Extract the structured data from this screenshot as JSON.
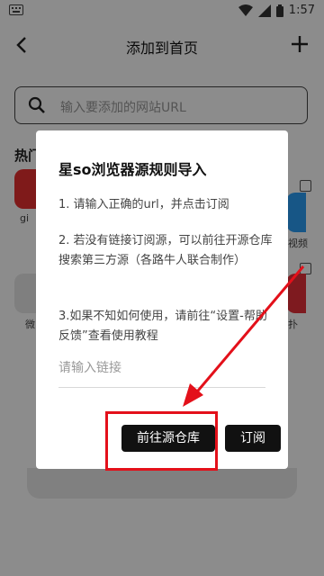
{
  "status_bar": {
    "time": "1:57",
    "left_icon": "keyboard-icon"
  },
  "header": {
    "title": "添加到首页",
    "back_icon": "back-arrow-icon",
    "add_icon": "plus-icon"
  },
  "search": {
    "placeholder": "输入要添加的网站URL",
    "icon": "search-icon"
  },
  "hot": {
    "title_fragment": "热门",
    "left_labels": [
      "gi",
      "微"
    ],
    "right_labels": [
      "视频",
      "扑"
    ]
  },
  "dialog": {
    "title": "星so浏览器源规则导入",
    "step1": "1. 请输入正确的url，并点击订阅",
    "step2": "2. 若没有链接订阅源，可以前往开源仓库搜索第三方源（各路牛人联合制作）",
    "step3": "3.如果不知如何使用，请前往“设置-帮助反馈”查看使用教程",
    "input_placeholder": "请输入链接",
    "repo_button": "前往源仓库",
    "subscribe_button": "订阅"
  },
  "annotation": {
    "color": "#e3101a"
  }
}
